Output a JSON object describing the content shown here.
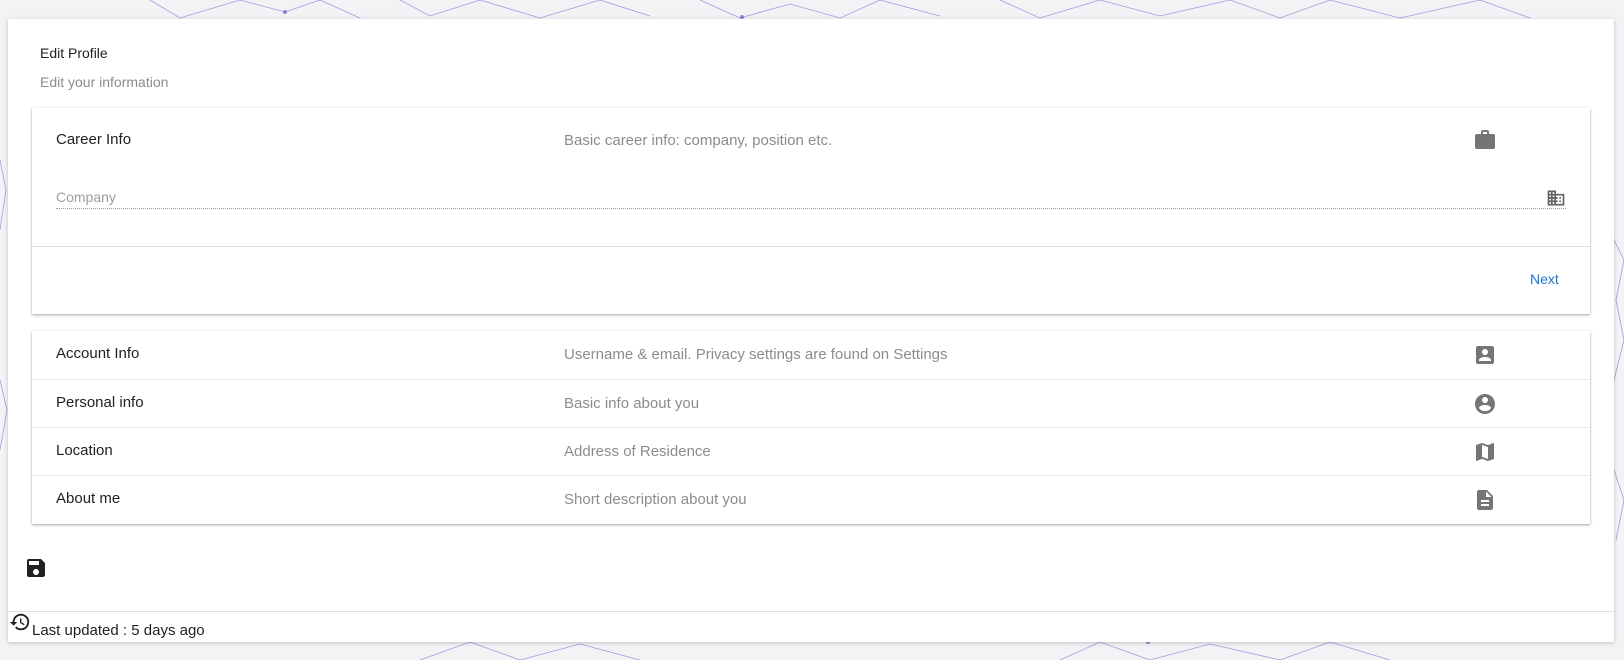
{
  "header": {
    "title": "Edit Profile",
    "subtitle": "Edit your information"
  },
  "career": {
    "label": "Career Info",
    "description": "Basic career info: company, position etc.",
    "icon": "briefcase-icon",
    "company_field": {
      "placeholder": "Company",
      "value": "",
      "icon": "building-icon"
    },
    "next_label": "Next"
  },
  "sections": [
    {
      "label": "Account Info",
      "description": "Username & email. Privacy settings are found on Settings",
      "icon": "account-box-icon"
    },
    {
      "label": "Personal info",
      "description": "Basic info about you",
      "icon": "account-circle-icon"
    },
    {
      "label": "Location",
      "description": "Address of Residence",
      "icon": "map-icon"
    },
    {
      "label": "About me",
      "description": "Short description about you",
      "icon": "description-icon"
    }
  ],
  "save": {
    "icon": "save-icon"
  },
  "footer": {
    "icon": "history-icon",
    "last_updated": "Last updated : 5 days ago"
  },
  "colors": {
    "accent": "#1976d2",
    "background": "#f3f3f6",
    "card": "#ffffff",
    "secondary_text": "#8c8c8c",
    "icon": "#757575",
    "network_lines": "#4b4bc8"
  }
}
